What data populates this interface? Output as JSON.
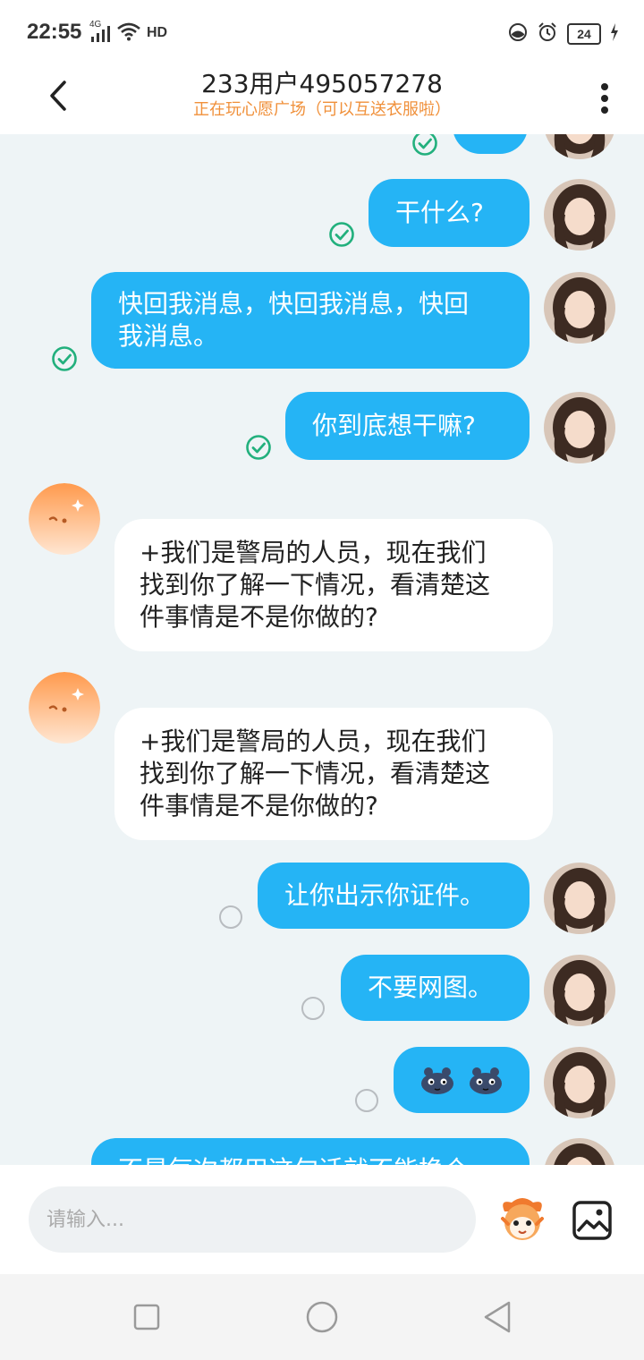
{
  "status_bar": {
    "time": "22:55",
    "network": "4G",
    "signal_extra": "HD",
    "battery": "24"
  },
  "header": {
    "title": "233用户495057278",
    "subtitle": "正在玩心愿广场（可以互送衣服啦）"
  },
  "messages": [
    {
      "text": "干什么?"
    },
    {
      "text_line1": "快回我消息，快回我消息，快回",
      "text_line2": "我消息。"
    },
    {
      "text": "你到底想干嘛?"
    },
    {
      "line1": "+我们是警局的人员，现在我们",
      "line2": "找到你了解一下情况，看清楚这",
      "line3": "件事情是不是你做的?"
    },
    {
      "line1": "+我们是警局的人员，现在我们",
      "line2": "找到你了解一下情况，看清楚这",
      "line3": "件事情是不是你做的?"
    },
    {
      "text": "让你出示你证件。"
    },
    {
      "text": "不要网图。"
    },
    {
      "text": ""
    },
    {
      "text": "不是每次都用这句话就不能换个"
    }
  ],
  "input": {
    "placeholder": "请输入..."
  },
  "icons": {
    "back": "chevron-left-icon",
    "more": "more-vertical-icon",
    "sent": "check-circle-icon",
    "pending": "pending-circle-icon",
    "emoji": "mascot-emoji-icon",
    "image": "image-icon"
  },
  "colors": {
    "out_bubble": "#25b4f5",
    "in_bubble": "#ffffff",
    "subtitle": "#f0903a",
    "check": "#22b07d",
    "background": "#eef4f6"
  }
}
